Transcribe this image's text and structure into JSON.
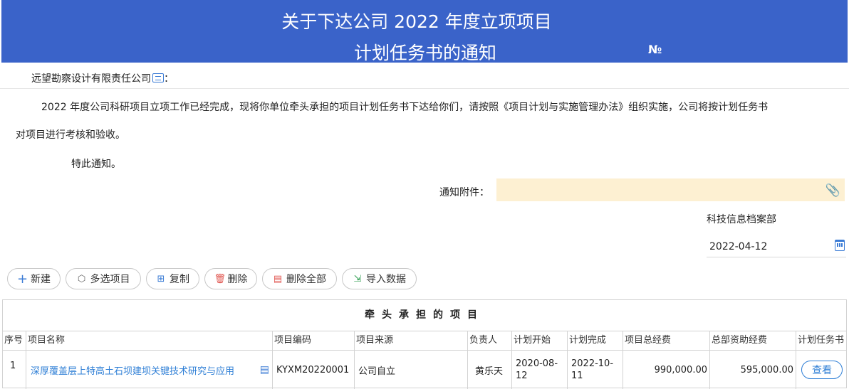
{
  "header": {
    "title_line1": "关于下达公司 2022 年度立项项目",
    "title_line2": "计划任务书的通知",
    "number_label": "№"
  },
  "notice": {
    "company": "远望勘察设计有限责任公司",
    "company_suffix": "：",
    "paragraph1": "2022 年度公司科研项目立项工作已经完成，现将你单位牵头承担的项目计划任务书下达给你们，请按照《项目计划与实施管理办法》组织实施，公司将按计划任务书",
    "paragraph2": "对项目进行考核和验收。",
    "closing": "特此通知。",
    "attachment_label": "通知附件：",
    "attachment_value": "",
    "department": "科技信息档案部",
    "date": "2022-04-12"
  },
  "toolbar": {
    "new": "新建",
    "multi_select": "多选项目",
    "copy": "复制",
    "delete": "删除",
    "delete_all": "删除全部",
    "import": "导入数据"
  },
  "table": {
    "caption": "牵头承担的项目",
    "columns": [
      "序号",
      "项目名称",
      "项目编码",
      "项目来源",
      "负责人",
      "计划开始",
      "计划完成",
      "项目总经费",
      "总部资助经费",
      "计划任务书"
    ],
    "rows": [
      {
        "index": "1",
        "name": "深厚覆盖层上特高土石坝建坝关键技术研究与应用",
        "code": "KYXM20220001",
        "source": "公司自立",
        "owner": "黄乐天",
        "start": "2020-08-12",
        "end": "2022-10-11",
        "total": "990,000.00",
        "hq_fund": "595,000.00",
        "action": "查看"
      }
    ]
  }
}
